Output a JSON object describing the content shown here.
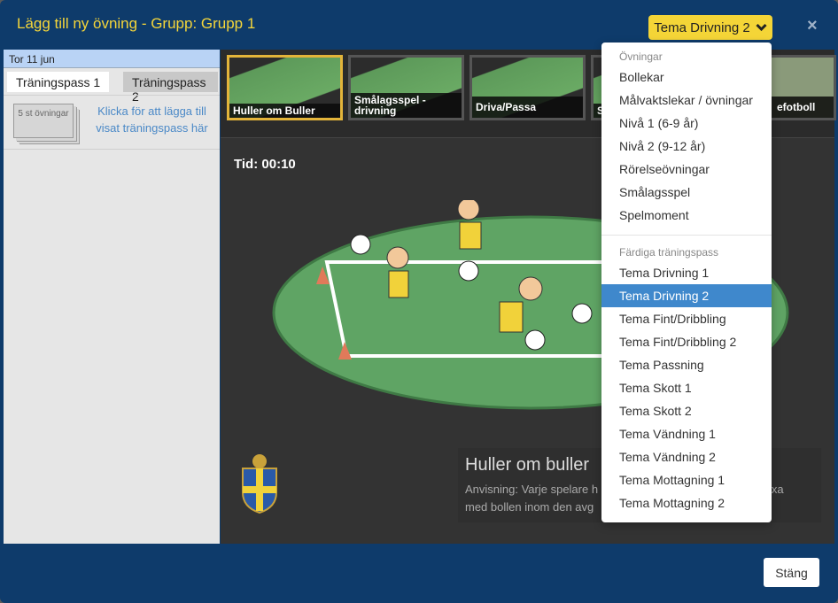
{
  "header": {
    "title": "Lägg till ny övning - Grupp: Grupp 1",
    "theme_button": "Tema Drivning 2",
    "close": "×"
  },
  "left": {
    "date": "Tor 11 jun",
    "tabs": [
      {
        "label": "Träningspass 1",
        "active": true
      },
      {
        "label": "Träningspass 2",
        "active": false
      }
    ],
    "stack_label": "5 st övningar",
    "add_text": "Klicka för att lägga till visat träningspass här"
  },
  "thumbnails": [
    {
      "label": "Huller om Buller",
      "selected": true
    },
    {
      "label": "Smålagsspel - drivning"
    },
    {
      "label": "Driva/Passa"
    },
    {
      "label": "S t"
    },
    {
      "label": ""
    },
    {
      "label": "efotboll"
    }
  ],
  "main": {
    "time": "Tid: 00:10",
    "exercise_title": "Huller om buller"
  },
  "instruction_parts": [
    "Anvisning: Varje spelare h",
    "trixa",
    "med bollen inom den avg"
  ],
  "dropdown": {
    "groups": [
      {
        "header": "Övningar",
        "items": [
          "Bollekar",
          "Målvaktslekar / övningar",
          "Nivå 1 (6-9 år)",
          "Nivå 2 (9-12 år)",
          "Rörelseövningar",
          "Smålagsspel",
          "Spelmoment"
        ]
      },
      {
        "header": "Färdiga träningspass",
        "items": [
          "Tema Drivning 1",
          "Tema Drivning 2",
          "Tema Fint/Dribbling",
          "Tema Fint/Dribbling 2",
          "Tema Passning",
          "Tema Skott 1",
          "Tema Skott 2",
          "Tema Vändning 1",
          "Tema Vändning 2",
          "Tema Mottagning 1",
          "Tema Mottagning 2"
        ]
      }
    ],
    "selected": "Tema Drivning 2"
  },
  "footer": {
    "close_button": "Stäng"
  },
  "colors": {
    "header_bg": "#0e3b6b",
    "title": "#f5d63a",
    "accent": "#f4d537",
    "selected_item": "#3f88cc"
  }
}
